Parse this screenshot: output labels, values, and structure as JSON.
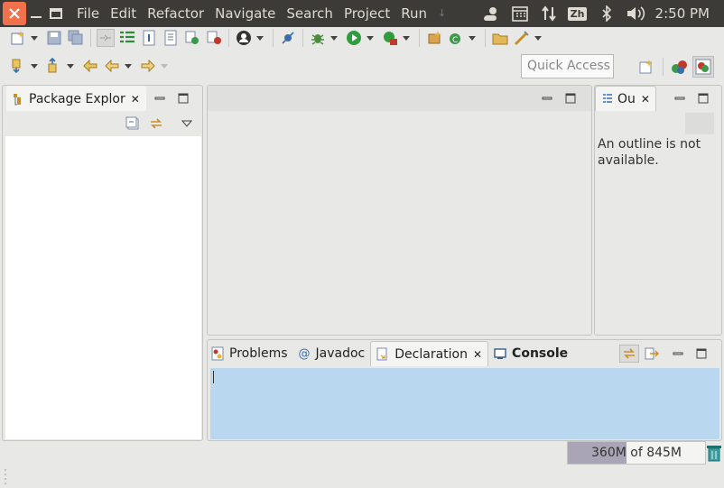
{
  "menubar": {
    "items": [
      "File",
      "Edit",
      "Refactor",
      "Navigate",
      "Search",
      "Project",
      "Run"
    ],
    "clock": "2:50 PM",
    "input_method": "Zh"
  },
  "quick_access": {
    "placeholder": "Quick Access"
  },
  "package_explorer": {
    "title": "Package Explor"
  },
  "outline": {
    "title": "Ou",
    "message": "An outline is not available."
  },
  "bottom_tabs": [
    {
      "label": "Problems"
    },
    {
      "label": "Javadoc"
    },
    {
      "label": "Declaration"
    },
    {
      "label": "Console"
    }
  ],
  "heap": {
    "text": "360M of 845M",
    "used_fraction": 0.43
  },
  "colors": {
    "menubar": "#3c3b37",
    "close_button": "#f0714b",
    "selection": "#bad7f0"
  }
}
